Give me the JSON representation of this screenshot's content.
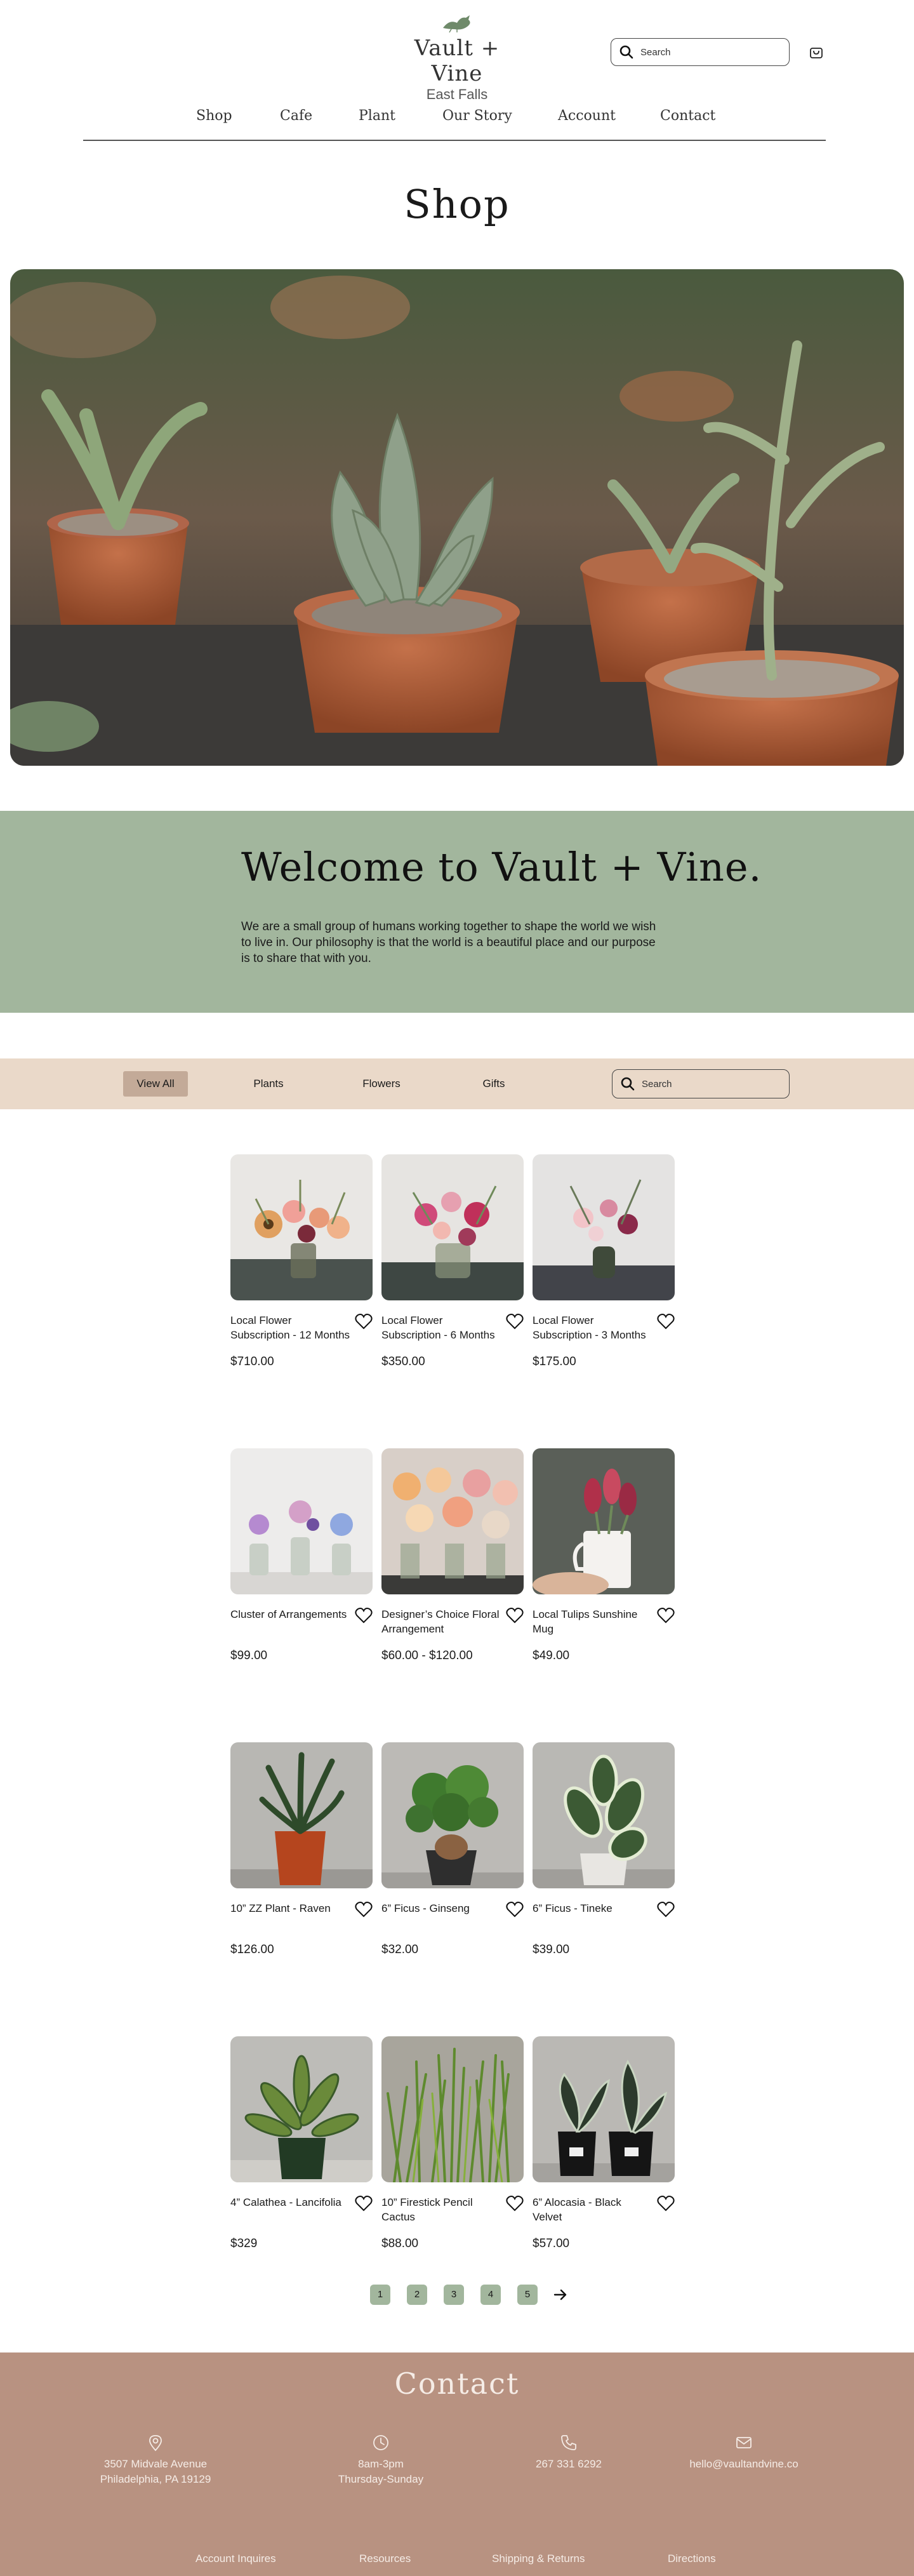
{
  "brand": {
    "name": "Vault + Vine",
    "location": "East Falls"
  },
  "header": {
    "search_placeholder": "Search",
    "nav": [
      "Shop",
      "Cafe",
      "Plant",
      "Our Story",
      "Account",
      "Contact"
    ]
  },
  "page_title": "Shop",
  "welcome": {
    "heading": "Welcome to Vault + Vine.",
    "body": "We are a small group of humans working together to shape the world we wish to live in. Our philosophy is that the world is a beautiful place and our purpose is to share that with you."
  },
  "filters": {
    "items": [
      "View All",
      "Plants",
      "Flowers",
      "Gifts"
    ],
    "active": "View All",
    "search_placeholder": "Search"
  },
  "products": [
    {
      "name": "Local Flower Subscription - 12 Months",
      "price": "$710.00"
    },
    {
      "name": "Local Flower Subscription - 6 Months",
      "price": "$350.00"
    },
    {
      "name": "Local Flower Subscription - 3 Months",
      "price": "$175.00"
    },
    {
      "name": "Cluster of Arrangements",
      "price": "$99.00"
    },
    {
      "name": "Designer’s Choice Floral Arrangement",
      "price": "$60.00 - $120.00"
    },
    {
      "name": "Local Tulips Sunshine Mug",
      "price": "$49.00"
    },
    {
      "name": "10” ZZ Plant - Raven",
      "price": "$126.00"
    },
    {
      "name": "6” Ficus - Ginseng",
      "price": "$32.00"
    },
    {
      "name": "6” Ficus - Tineke",
      "price": "$39.00"
    },
    {
      "name": "4” Calathea - Lancifolia",
      "price": "$329"
    },
    {
      "name": "10” Firestick Pencil Cactus",
      "price": "$88.00"
    },
    {
      "name": "6” Alocasia - Black Velvet",
      "price": "$57.00"
    }
  ],
  "pagination": {
    "pages": [
      "1",
      "2",
      "3",
      "4",
      "5"
    ],
    "next_icon": "arrow-right-icon"
  },
  "footer": {
    "heading": "Contact",
    "address_line1": "3507 Midvale Avenue",
    "address_line2": "Philadelphia, PA 19129",
    "hours_line1": "8am-3pm",
    "hours_line2": "Thursday-Sunday",
    "phone": "267 331 6292",
    "email": "hello@vaultandvine.co",
    "links": [
      "Account Inquires",
      "Resources",
      "Shipping & Returns",
      "Directions"
    ]
  },
  "colors": {
    "sage": "#a2b69d",
    "sand": "#ead9c9",
    "tan_active": "#c3aa98",
    "terracotta_footer": "#b89281"
  }
}
